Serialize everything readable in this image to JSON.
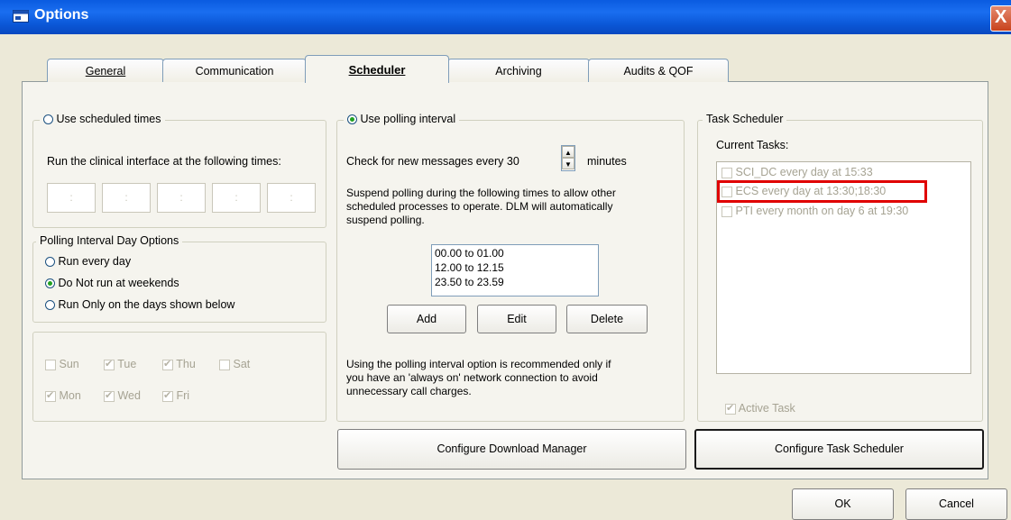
{
  "window": {
    "title": "Options",
    "close_label": "X"
  },
  "tabs": [
    {
      "label": "General",
      "selected": false
    },
    {
      "label": "Communication",
      "selected": false
    },
    {
      "label": "Scheduler",
      "selected": true
    },
    {
      "label": "Archiving",
      "selected": false
    },
    {
      "label": "Audits & QOF",
      "selected": false
    }
  ],
  "scheduled": {
    "radio_label": "Use scheduled times",
    "selected": false,
    "run_text": "Run the clinical interface at the following times:",
    "time_separator": ":"
  },
  "day_options": {
    "legend": "Polling Interval Day Options",
    "options": [
      {
        "label": "Run every day",
        "selected": false
      },
      {
        "label": "Do Not run at weekends",
        "selected": true
      },
      {
        "label": "Run Only on the days shown below",
        "selected": false
      }
    ]
  },
  "days": [
    {
      "label": "Sun",
      "checked": false
    },
    {
      "label": "Tue",
      "checked": true
    },
    {
      "label": "Thu",
      "checked": true
    },
    {
      "label": "Sat",
      "checked": false
    },
    {
      "label": "Mon",
      "checked": true
    },
    {
      "label": "Wed",
      "checked": true
    },
    {
      "label": "Fri",
      "checked": true
    }
  ],
  "polling": {
    "radio_label": "Use polling interval",
    "selected": true,
    "check_prefix": "Check for new messages every",
    "interval_value": "30",
    "check_suffix": "minutes",
    "suspend_line1": "Suspend polling during the following times to allow other",
    "suspend_line2": "scheduled processes to operate. DLM will automatically",
    "suspend_line3": "suspend polling.",
    "periods": [
      "00.00 to 01.00",
      "12.00 to 12.15",
      "23.50 to 23.59"
    ],
    "add_label": "Add",
    "edit_label": "Edit",
    "delete_label": "Delete",
    "note_line1": "Using the polling interval option is recommended only if",
    "note_line2": "you have an 'always on' network connection to avoid",
    "note_line3": "unnecessary call charges."
  },
  "task_scheduler": {
    "legend": "Task Scheduler",
    "current_tasks_label": "Current Tasks:",
    "tasks": [
      "SCI_DC every day at 15:33",
      "ECS every day at 13:30;18:30",
      "PTI every month on day 6 at 19:30"
    ],
    "active_task_label": "Active Task",
    "active_task_checked": true,
    "highlight_color": "#e00000"
  },
  "buttons": {
    "configure_download": "Configure Download Manager",
    "configure_task": "Configure Task Scheduler",
    "ok": "OK",
    "cancel": "Cancel"
  }
}
